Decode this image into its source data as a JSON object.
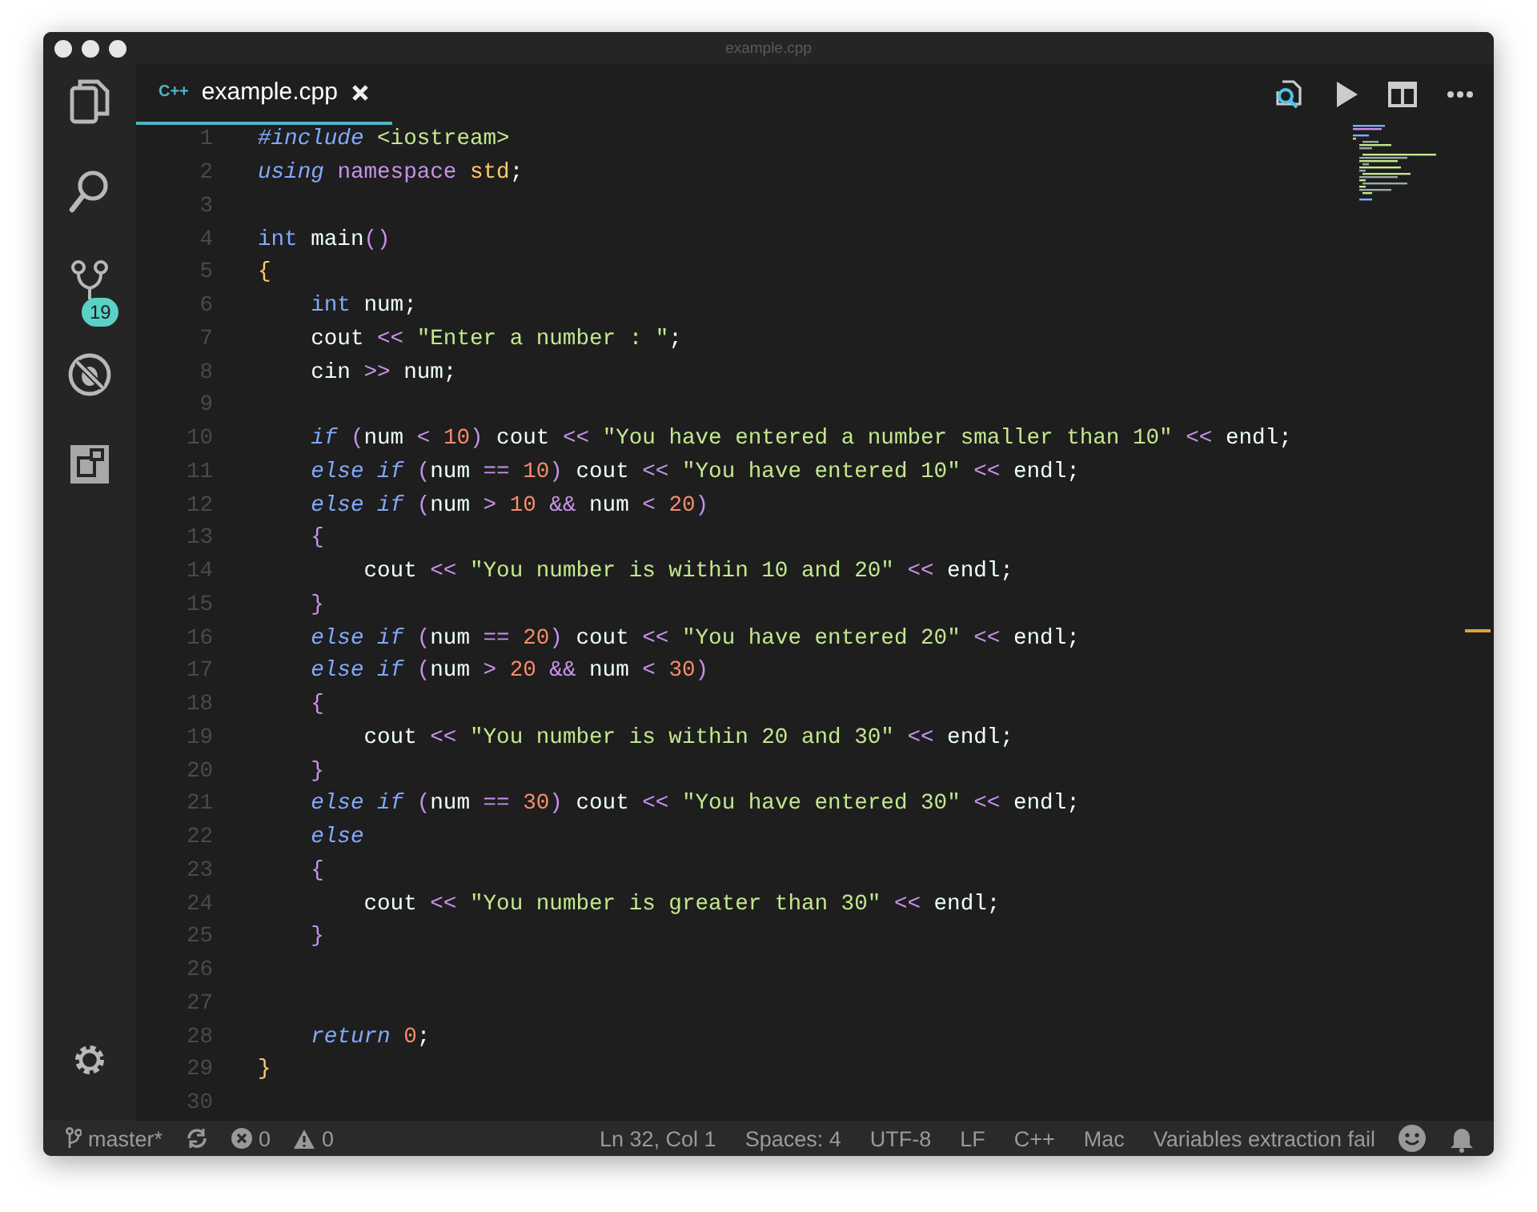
{
  "window": {
    "title": "example.cpp"
  },
  "activity_bar": {
    "scm_badge": "19"
  },
  "tabs": [
    {
      "file_icon": "C++",
      "label": "example.cpp",
      "selected": true
    }
  ],
  "editor": {
    "lines": [
      {
        "number": "1",
        "tokens": [
          {
            "kind": "ctrl",
            "text": "#include "
          },
          {
            "kind": "lib",
            "text": "<iostream>"
          }
        ]
      },
      {
        "number": "2",
        "tokens": [
          {
            "kind": "ctrl",
            "text": "using "
          },
          {
            "kind": "ns",
            "text": "namespace "
          },
          {
            "kind": "cls",
            "text": "std"
          },
          {
            "kind": "p",
            "text": ";"
          }
        ]
      },
      {
        "number": "3"
      },
      {
        "number": "4",
        "tokens": [
          {
            "kind": "type",
            "text": "int"
          },
          {
            "kind": "p",
            "text": " main"
          },
          {
            "kind": "op",
            "text": "()"
          }
        ]
      },
      {
        "number": "5",
        "tokens": [
          {
            "kind": "brace",
            "text": "{"
          }
        ]
      },
      {
        "number": "6",
        "tokens": [
          {
            "kind": "type",
            "text": "    int"
          },
          {
            "kind": "p",
            "text": " num;"
          }
        ]
      },
      {
        "number": "7",
        "tokens": [
          {
            "kind": "p",
            "text": "    cout "
          },
          {
            "kind": "op",
            "text": "<< "
          },
          {
            "kind": "str",
            "text": "\"Enter a number : \""
          },
          {
            "kind": "p",
            "text": ";"
          }
        ]
      },
      {
        "number": "8",
        "tokens": [
          {
            "kind": "p",
            "text": "    cin "
          },
          {
            "kind": "op",
            "text": ">>"
          },
          {
            "kind": "p",
            "text": " num;"
          }
        ]
      },
      {
        "number": "9"
      },
      {
        "number": "10",
        "tokens": [
          {
            "kind": "ctrl",
            "text": "    if "
          },
          {
            "kind": "op",
            "text": "("
          },
          {
            "kind": "p",
            "text": "num "
          },
          {
            "kind": "op",
            "text": "< "
          },
          {
            "kind": "num",
            "text": "10"
          },
          {
            "kind": "op",
            "text": ")"
          },
          {
            "kind": "p",
            "text": " cout "
          },
          {
            "kind": "op",
            "text": "<< "
          },
          {
            "kind": "str",
            "text": "\"You have entered a number smaller than 10\" "
          },
          {
            "kind": "op",
            "text": "<<"
          },
          {
            "kind": "p",
            "text": " endl;"
          }
        ]
      },
      {
        "number": "11",
        "tokens": [
          {
            "kind": "ctrl",
            "text": "    else if "
          },
          {
            "kind": "op",
            "text": "("
          },
          {
            "kind": "p",
            "text": "num "
          },
          {
            "kind": "op",
            "text": "== "
          },
          {
            "kind": "num",
            "text": "10"
          },
          {
            "kind": "op",
            "text": ")"
          },
          {
            "kind": "p",
            "text": " cout "
          },
          {
            "kind": "op",
            "text": "<< "
          },
          {
            "kind": "str",
            "text": "\"You have entered 10\" "
          },
          {
            "kind": "op",
            "text": "<<"
          },
          {
            "kind": "p",
            "text": " endl;"
          }
        ]
      },
      {
        "number": "12",
        "tokens": [
          {
            "kind": "ctrl",
            "text": "    else if "
          },
          {
            "kind": "op",
            "text": "("
          },
          {
            "kind": "p",
            "text": "num "
          },
          {
            "kind": "op",
            "text": "> "
          },
          {
            "kind": "num",
            "text": "10 "
          },
          {
            "kind": "op",
            "text": "&&"
          },
          {
            "kind": "p",
            "text": " num "
          },
          {
            "kind": "op",
            "text": "< "
          },
          {
            "kind": "num",
            "text": "20"
          },
          {
            "kind": "op",
            "text": ")"
          }
        ]
      },
      {
        "number": "13",
        "tokens": [
          {
            "kind": "op",
            "text": "    {"
          }
        ]
      },
      {
        "number": "14",
        "tokens": [
          {
            "kind": "p",
            "text": "        cout "
          },
          {
            "kind": "op",
            "text": "<< "
          },
          {
            "kind": "str",
            "text": "\"You number is within 10 and 20\" "
          },
          {
            "kind": "op",
            "text": "<<"
          },
          {
            "kind": "p",
            "text": " endl;"
          }
        ]
      },
      {
        "number": "15",
        "tokens": [
          {
            "kind": "op",
            "text": "    }"
          }
        ]
      },
      {
        "number": "16",
        "tokens": [
          {
            "kind": "ctrl",
            "text": "    else if "
          },
          {
            "kind": "op",
            "text": "("
          },
          {
            "kind": "p",
            "text": "num "
          },
          {
            "kind": "op",
            "text": "== "
          },
          {
            "kind": "num",
            "text": "20"
          },
          {
            "kind": "op",
            "text": ")"
          },
          {
            "kind": "p",
            "text": " cout "
          },
          {
            "kind": "op",
            "text": "<< "
          },
          {
            "kind": "str",
            "text": "\"You have entered 20\" "
          },
          {
            "kind": "op",
            "text": "<<"
          },
          {
            "kind": "p",
            "text": " endl;"
          }
        ]
      },
      {
        "number": "17",
        "tokens": [
          {
            "kind": "ctrl",
            "text": "    else if "
          },
          {
            "kind": "op",
            "text": "("
          },
          {
            "kind": "p",
            "text": "num "
          },
          {
            "kind": "op",
            "text": "> "
          },
          {
            "kind": "num",
            "text": "20 "
          },
          {
            "kind": "op",
            "text": "&&"
          },
          {
            "kind": "p",
            "text": " num "
          },
          {
            "kind": "op",
            "text": "< "
          },
          {
            "kind": "num",
            "text": "30"
          },
          {
            "kind": "op",
            "text": ")"
          }
        ]
      },
      {
        "number": "18",
        "tokens": [
          {
            "kind": "op",
            "text": "    {"
          }
        ]
      },
      {
        "number": "19",
        "tokens": [
          {
            "kind": "p",
            "text": "        cout "
          },
          {
            "kind": "op",
            "text": "<< "
          },
          {
            "kind": "str",
            "text": "\"You number is within 20 and 30\" "
          },
          {
            "kind": "op",
            "text": "<<"
          },
          {
            "kind": "p",
            "text": " endl;"
          }
        ]
      },
      {
        "number": "20",
        "tokens": [
          {
            "kind": "op",
            "text": "    }"
          }
        ]
      },
      {
        "number": "21",
        "tokens": [
          {
            "kind": "ctrl",
            "text": "    else if "
          },
          {
            "kind": "op",
            "text": "("
          },
          {
            "kind": "p",
            "text": "num "
          },
          {
            "kind": "op",
            "text": "== "
          },
          {
            "kind": "num",
            "text": "30"
          },
          {
            "kind": "op",
            "text": ")"
          },
          {
            "kind": "p",
            "text": " cout "
          },
          {
            "kind": "op",
            "text": "<< "
          },
          {
            "kind": "str",
            "text": "\"You have entered 30\" "
          },
          {
            "kind": "op",
            "text": "<<"
          },
          {
            "kind": "p",
            "text": " endl;"
          }
        ]
      },
      {
        "number": "22",
        "tokens": [
          {
            "kind": "ctrl",
            "text": "    else"
          }
        ]
      },
      {
        "number": "23",
        "tokens": [
          {
            "kind": "op",
            "text": "    {"
          }
        ]
      },
      {
        "number": "24",
        "tokens": [
          {
            "kind": "p",
            "text": "        cout "
          },
          {
            "kind": "op",
            "text": "<< "
          },
          {
            "kind": "str",
            "text": "\"You number is greater than 30\" "
          },
          {
            "kind": "op",
            "text": "<<"
          },
          {
            "kind": "p",
            "text": " endl;"
          }
        ]
      },
      {
        "number": "25",
        "tokens": [
          {
            "kind": "op",
            "text": "    }"
          }
        ]
      },
      {
        "number": "26"
      },
      {
        "number": "27"
      },
      {
        "number": "28",
        "tokens": [
          {
            "kind": "ctrl",
            "text": "    return "
          },
          {
            "kind": "num",
            "text": "0"
          },
          {
            "kind": "p",
            "text": ";"
          }
        ]
      },
      {
        "number": "29",
        "tokens": [
          {
            "kind": "brace",
            "text": "}"
          }
        ]
      },
      {
        "number": "30"
      }
    ]
  },
  "status_bar": {
    "branch": "master*",
    "errors": "0",
    "warnings": "0",
    "items": [
      "Ln 32, Col 1",
      "Spaces: 4",
      "UTF-8",
      "LF",
      "C++",
      "Mac",
      "Variables extraction fail"
    ]
  }
}
